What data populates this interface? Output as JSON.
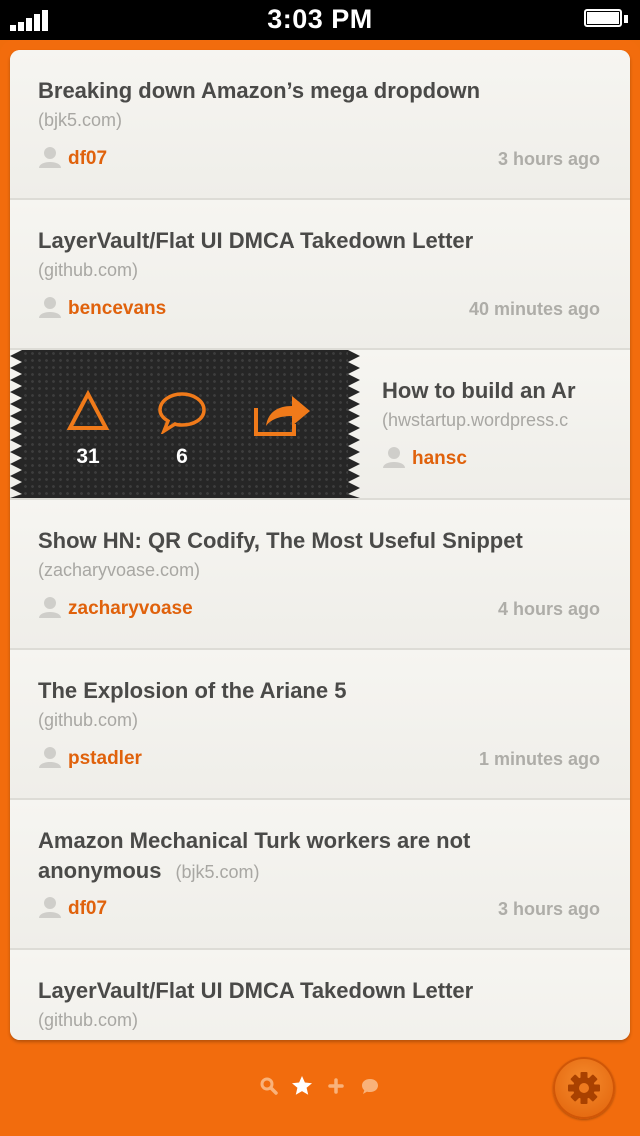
{
  "status_bar": {
    "time": "3:03 PM"
  },
  "stories": [
    {
      "title": "Breaking down Amazon’s mega dropdown",
      "domain": "(bjk5.com)",
      "user": "df07",
      "time": "3 hours ago"
    },
    {
      "title": "LayerVault/Flat UI DMCA Takedown Letter",
      "domain": "(github.com)",
      "user": "bencevans",
      "time": "40 minutes ago"
    },
    {
      "title": "How to build an Ar",
      "domain": "(hwstartup.wordpress.c",
      "user": "hansc",
      "actions": {
        "upvotes": "31",
        "comments": "6"
      }
    },
    {
      "title": "Show HN: QR Codify, The Most Useful Snippet",
      "domain": "(zacharyvoase.com)",
      "user": "zacharyvoase",
      "time": "4 hours ago"
    },
    {
      "title": "The Explosion of the Ariane 5",
      "domain": "(github.com)",
      "user": "pstadler",
      "time": "1 minutes ago"
    },
    {
      "title": "Amazon Mechanical Turk workers are not anonymous",
      "domain": "(bjk5.com)",
      "user": "df07",
      "time": "3 hours ago"
    },
    {
      "title": "LayerVault/Flat UI DMCA Takedown Letter",
      "domain": "(github.com)"
    }
  ],
  "tabs": [
    "search-icon",
    "star-icon",
    "plus-icon",
    "comment-icon"
  ],
  "colors": {
    "accent": "#f26c0d",
    "user": "#e0620c",
    "title": "#4a4a48",
    "muted": "#a8a7a3",
    "panel": "#262626"
  }
}
